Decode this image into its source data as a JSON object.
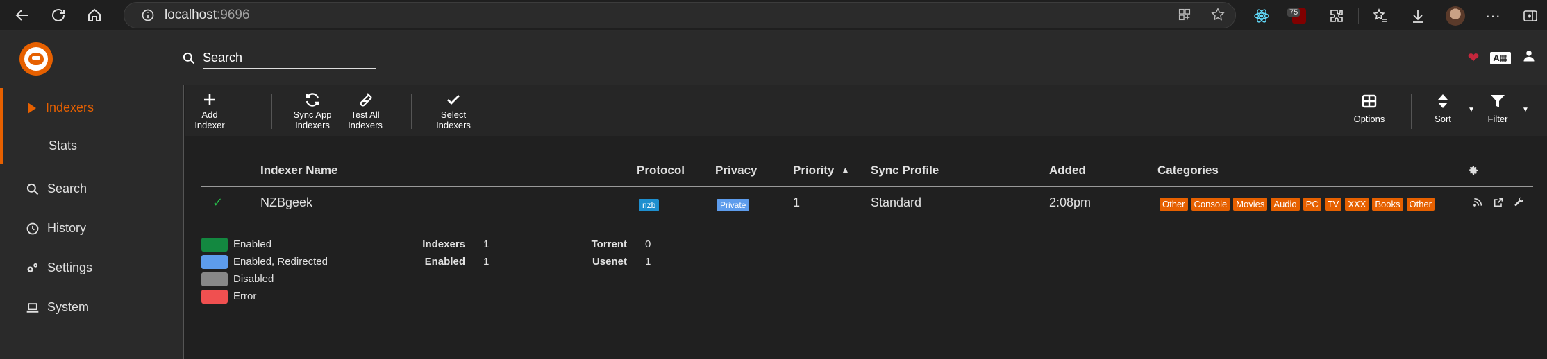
{
  "browser": {
    "url_host": "localhost",
    "url_port": ":9696",
    "ublock_count": "75"
  },
  "header": {
    "search_placeholder": "Search"
  },
  "sidebar": {
    "items": [
      {
        "label": "Indexers",
        "icon": "play-icon",
        "active": true
      },
      {
        "label": "Stats",
        "icon": "",
        "sub": true
      },
      {
        "label": "Search",
        "icon": "search-icon"
      },
      {
        "label": "History",
        "icon": "history-icon"
      },
      {
        "label": "Settings",
        "icon": "cogs-icon"
      },
      {
        "label": "System",
        "icon": "laptop-icon"
      }
    ]
  },
  "toolbar": {
    "add_indexer_l1": "Add",
    "add_indexer_l2": "Indexer",
    "sync_l1": "Sync App",
    "sync_l2": "Indexers",
    "test_l1": "Test All",
    "test_l2": "Indexers",
    "select_l1": "Select",
    "select_l2": "Indexers",
    "options": "Options",
    "sort": "Sort",
    "filter": "Filter"
  },
  "table": {
    "headers": {
      "name": "Indexer Name",
      "protocol": "Protocol",
      "privacy": "Privacy",
      "priority": "Priority",
      "sync_profile": "Sync Profile",
      "added": "Added",
      "categories": "Categories"
    },
    "rows": [
      {
        "name": "NZBgeek",
        "protocol": "nzb",
        "privacy": "Private",
        "priority": "1",
        "sync_profile": "Standard",
        "added": "2:08pm",
        "categories": [
          "Other",
          "Console",
          "Movies",
          "Audio",
          "PC",
          "TV",
          "XXX",
          "Books",
          "Other"
        ]
      }
    ]
  },
  "legend": [
    {
      "label": "Enabled",
      "color": "#138840"
    },
    {
      "label": "Enabled, Redirected",
      "color": "#5d9cec"
    },
    {
      "label": "Disabled",
      "color": "#888888"
    },
    {
      "label": "Error",
      "color": "#f05050"
    }
  ],
  "stats": {
    "indexers_label": "Indexers",
    "indexers_value": "1",
    "enabled_label": "Enabled",
    "enabled_value": "1",
    "torrent_label": "Torrent",
    "torrent_value": "0",
    "usenet_label": "Usenet",
    "usenet_value": "1"
  },
  "colors": {
    "accent": "#e66000",
    "heart": "#c4273c"
  }
}
